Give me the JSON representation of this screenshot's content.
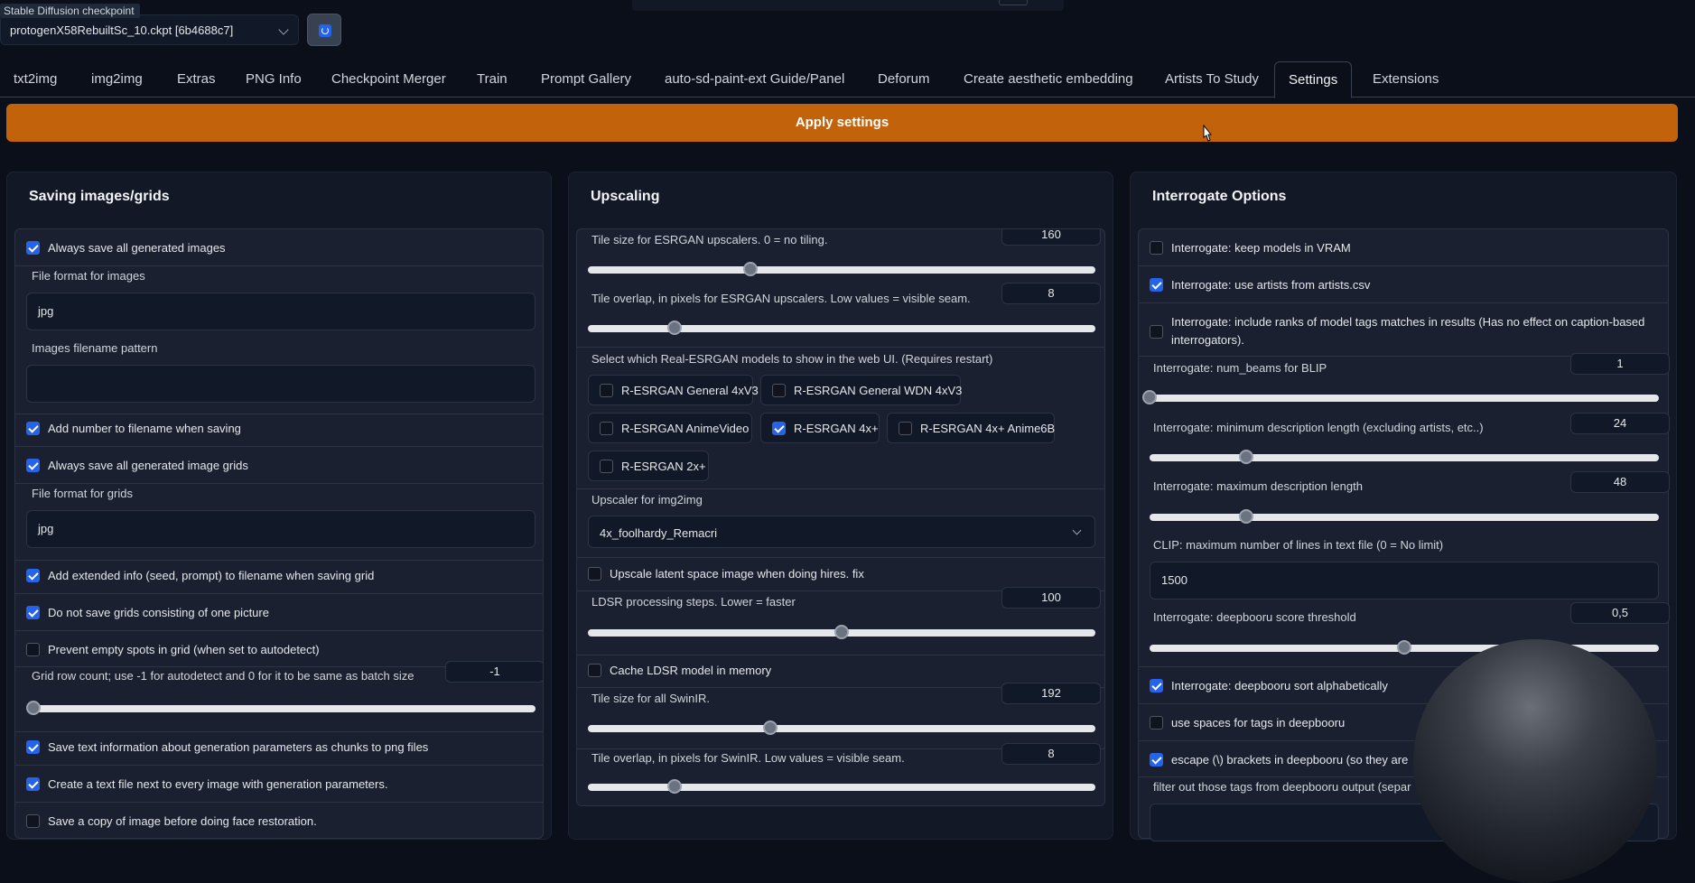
{
  "checkpoint": {
    "label": "Stable Diffusion checkpoint",
    "value": "protogenX58RebuiltSc_10.ckpt [6b4688c7]"
  },
  "tabs": [
    {
      "label": "txt2img"
    },
    {
      "label": "img2img"
    },
    {
      "label": "Extras"
    },
    {
      "label": "PNG Info"
    },
    {
      "label": "Checkpoint Merger"
    },
    {
      "label": "Train"
    },
    {
      "label": "Prompt Gallery"
    },
    {
      "label": "auto-sd-paint-ext Guide/Panel"
    },
    {
      "label": "Deforum"
    },
    {
      "label": "Create aesthetic embedding"
    },
    {
      "label": "Artists To Study"
    },
    {
      "label": "Settings",
      "active": true
    },
    {
      "label": "Extensions"
    }
  ],
  "apply_button": "Apply settings",
  "saving": {
    "title": "Saving images/grids",
    "always_save_images": {
      "label": "Always save all generated images",
      "checked": true
    },
    "file_format_images": {
      "label": "File format for images",
      "value": "jpg"
    },
    "filename_pattern": {
      "label": "Images filename pattern",
      "value": ""
    },
    "add_number": {
      "label": "Add number to filename when saving",
      "checked": true
    },
    "always_save_grids": {
      "label": "Always save all generated image grids",
      "checked": true
    },
    "file_format_grids": {
      "label": "File format for grids",
      "value": "jpg"
    },
    "add_extended_info": {
      "label": "Add extended info (seed, prompt) to filename when saving grid",
      "checked": true
    },
    "no_single_grids": {
      "label": "Do not save grids consisting of one picture",
      "checked": true
    },
    "prevent_empty_spots": {
      "label": "Prevent empty spots in grid (when set to autodetect)",
      "checked": false
    },
    "grid_row_count": {
      "label": "Grid row count; use -1 for autodetect and 0 for it to be same as batch size",
      "value": "-1",
      "fraction": 0
    },
    "save_text_chunks": {
      "label": "Save text information about generation parameters as chunks to png files",
      "checked": true
    },
    "create_text_file": {
      "label": "Create a text file next to every image with generation parameters.",
      "checked": true
    },
    "save_before_face": {
      "label": "Save a copy of image before doing face restoration.",
      "checked": false
    }
  },
  "upscaling": {
    "title": "Upscaling",
    "esrgan_tile": {
      "label": "Tile size for ESRGAN upscalers. 0 = no tiling.",
      "value": "160",
      "fraction": 0.32
    },
    "esrgan_overlap": {
      "label": "Tile overlap, in pixels for ESRGAN upscalers. Low values = visible seam.",
      "value": "8",
      "fraction": 0.17
    },
    "realesrgan_label": "Select which Real-ESRGAN models to show in the web UI. (Requires restart)",
    "models": [
      {
        "label": "R-ESRGAN General 4xV3",
        "checked": false
      },
      {
        "label": "R-ESRGAN General WDN 4xV3",
        "checked": false
      },
      {
        "label": "R-ESRGAN AnimeVideo",
        "checked": false
      },
      {
        "label": "R-ESRGAN 4x+",
        "checked": true
      },
      {
        "label": "R-ESRGAN 4x+ Anime6B",
        "checked": false
      },
      {
        "label": "R-ESRGAN 2x+",
        "checked": false
      }
    ],
    "img2img_upscaler": {
      "label": "Upscaler for img2img",
      "value": "4x_foolhardy_Remacri"
    },
    "upscale_latent": {
      "label": "Upscale latent space image when doing hires. fix",
      "checked": false
    },
    "ldsr_steps": {
      "label": "LDSR processing steps. Lower = faster",
      "value": "100",
      "fraction": 0.5
    },
    "cache_ldsr": {
      "label": "Cache LDSR model in memory",
      "checked": false
    },
    "swinir_tile": {
      "label": "Tile size for all SwinIR.",
      "value": "192",
      "fraction": 0.36
    },
    "swinir_overlap": {
      "label": "Tile overlap, in pixels for SwinIR. Low values = visible seam.",
      "value": "8",
      "fraction": 0.17
    }
  },
  "interrogate": {
    "title": "Interrogate Options",
    "keep_vram": {
      "label": "Interrogate: keep models in VRAM",
      "checked": false
    },
    "use_artists": {
      "label": "Interrogate: use artists from artists.csv",
      "checked": true
    },
    "include_ranks": {
      "label": "Interrogate: include ranks of model tags matches in results (Has no effect on caption-based",
      "label2": "interrogators).",
      "checked": false
    },
    "num_beams": {
      "label": "Interrogate: num_beams for BLIP",
      "value": "1",
      "fraction": 0
    },
    "min_desc": {
      "label": "Interrogate: minimum description length (excluding artists, etc..)",
      "value": "24",
      "fraction": 0.19
    },
    "max_desc": {
      "label": "Interrogate: maximum description length",
      "value": "48",
      "fraction": 0.19
    },
    "clip_max_lines": {
      "label": "CLIP: maximum number of lines in text file (0 = No limit)",
      "value": "1500"
    },
    "deepbooru_threshold": {
      "label": "Interrogate: deepbooru score threshold",
      "value": "0,5",
      "fraction": 0.5
    },
    "deepbooru_sort": {
      "label": "Interrogate: deepbooru sort alphabetically",
      "checked": true
    },
    "use_spaces": {
      "label": "use spaces for tags in deepbooru",
      "checked": false
    },
    "escape_brackets": {
      "label": "escape (\\) brackets in deepbooru (so they are",
      "checked": true
    },
    "filter_tags": {
      "label": "filter out those tags from deepbooru output (separ"
    }
  }
}
